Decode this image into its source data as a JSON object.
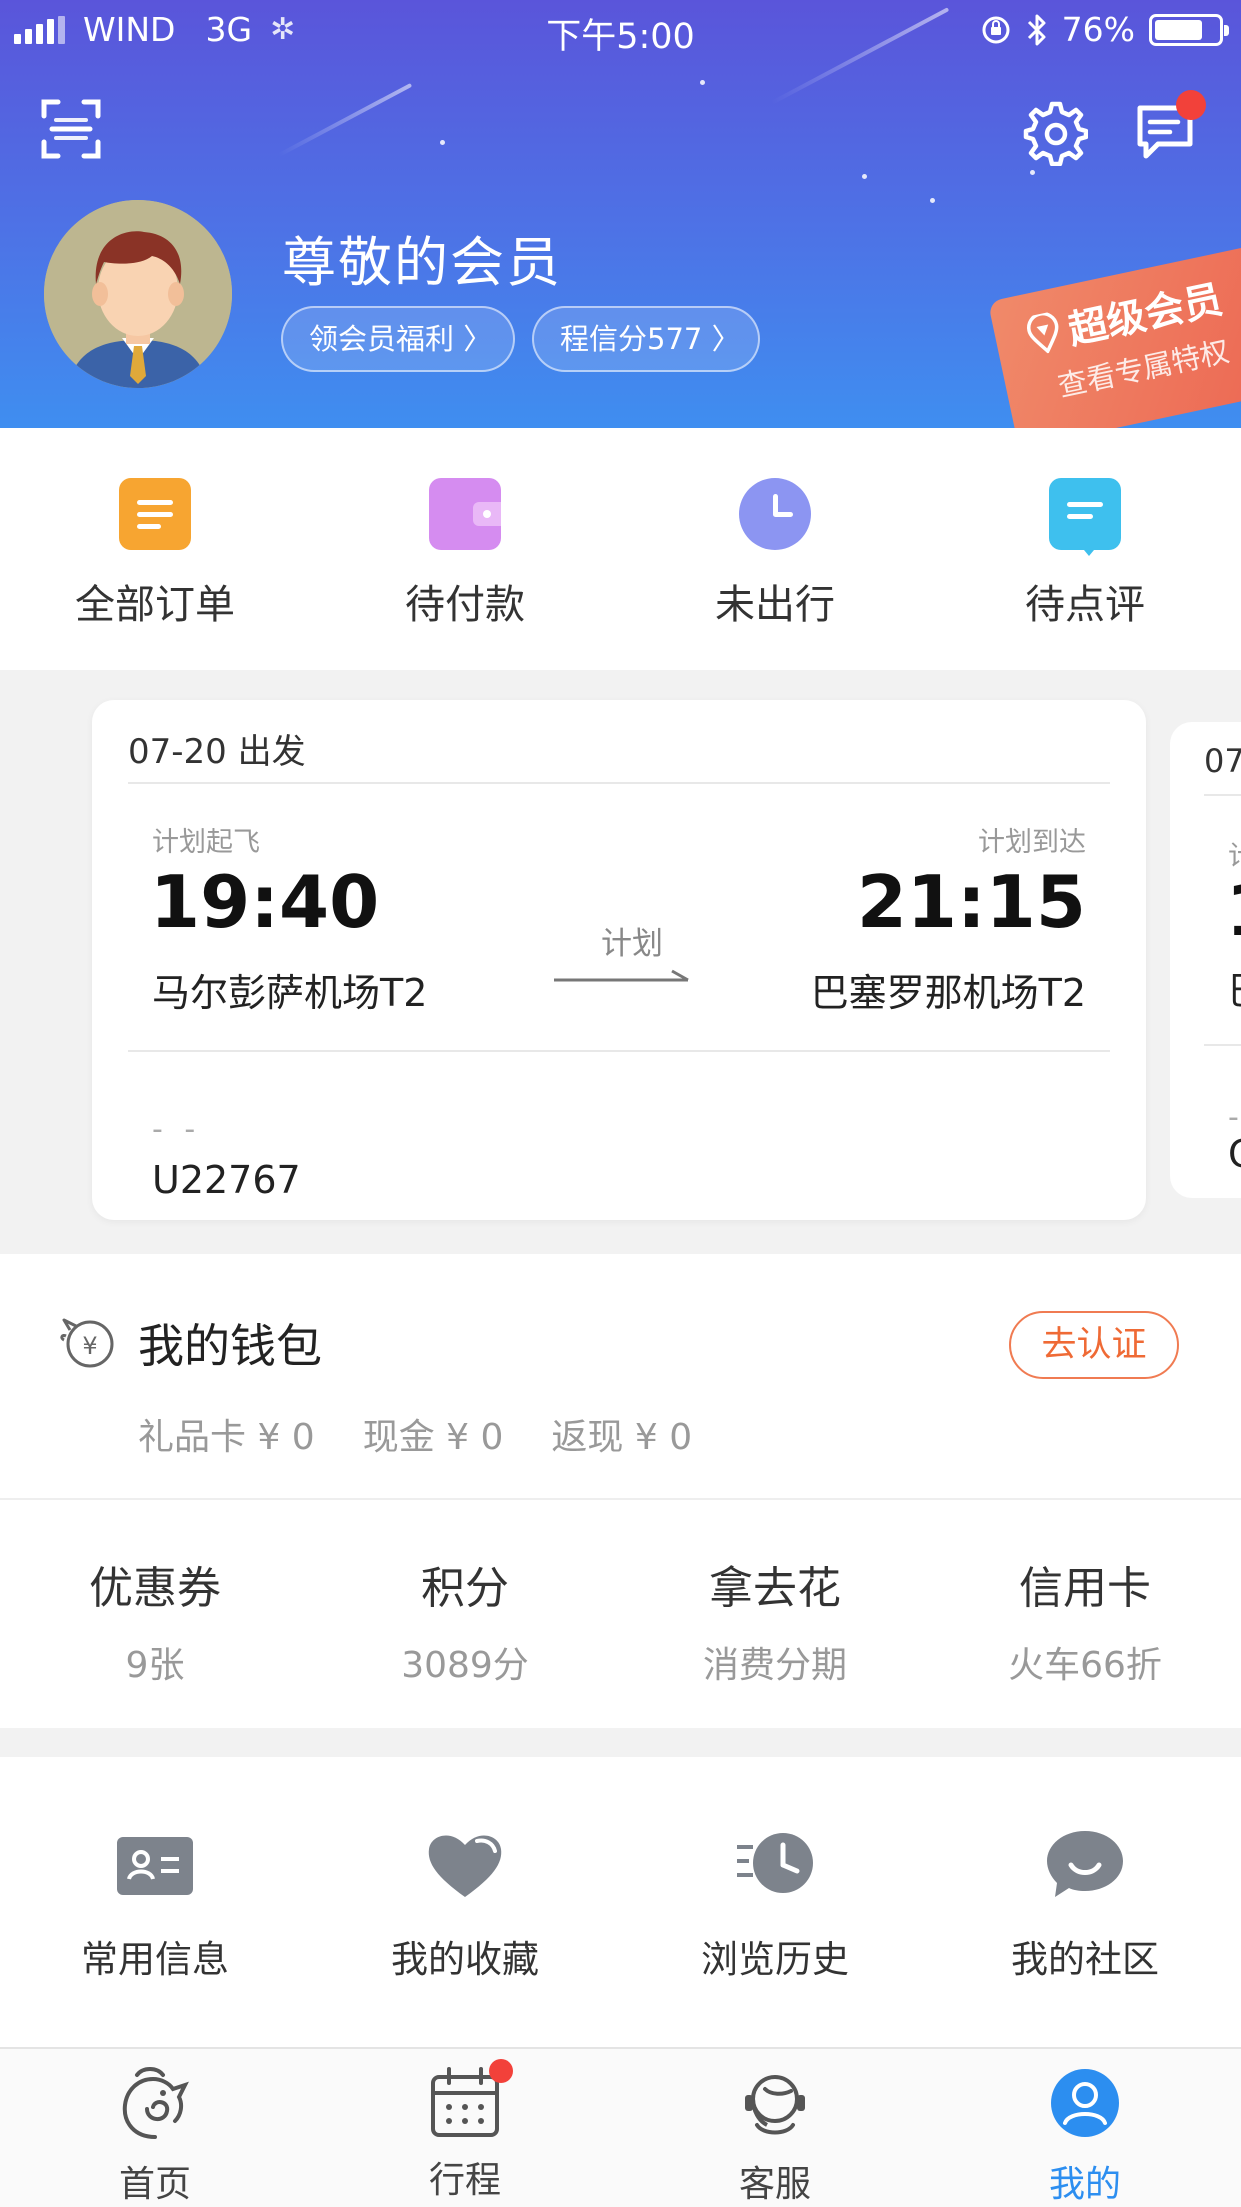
{
  "status_bar": {
    "carrier": "WIND",
    "network": "3G",
    "time": "下午5:00",
    "battery": "76%",
    "battery_level": 0.76
  },
  "header": {
    "icons": [
      "scan-icon",
      "settings-icon",
      "message-icon"
    ],
    "user_name": "尊敬的会员",
    "benefit_link": "领会员福利 〉",
    "credit_link": "程信分577 〉",
    "super_member": {
      "title": "超级会员",
      "subtitle": "查看专属特权"
    }
  },
  "orders": [
    {
      "label": "全部订单",
      "icon": "all-orders-icon",
      "color": "#f7a531"
    },
    {
      "label": "待付款",
      "icon": "wallet-icon",
      "color": "#d58cf0"
    },
    {
      "label": "未出行",
      "icon": "clock-icon",
      "color": "#8c95f2"
    },
    {
      "label": "待点评",
      "icon": "comment-icon",
      "color": "#3ec0ee"
    }
  ],
  "trip_card": {
    "date": "07-20 出发",
    "depart_label": "计划起飞",
    "arrive_label": "计划到达",
    "depart_time": "19:40",
    "arrive_time": "21:15",
    "depart_airport": "马尔彭萨机场T2",
    "arrive_airport": "巴塞罗那机场T2",
    "status": "计划",
    "seat_placeholder": "- -",
    "flight_no": "U22767"
  },
  "trip_card_next": {
    "date_partial": "07",
    "label_partial": "计",
    "time_partial": "1",
    "airport_partial": "巴",
    "dash_partial": "-",
    "flight_partial": "C"
  },
  "wallet": {
    "title": "我的钱包",
    "verify_button": "去认证",
    "gift_card": "礼品卡 ¥ 0",
    "cash": "现金 ¥ 0",
    "cashback": "返现 ¥ 0",
    "assets": [
      {
        "title": "优惠券",
        "sub": "9张"
      },
      {
        "title": "积分",
        "sub": "3089分"
      },
      {
        "title": "拿去花",
        "sub": "消费分期"
      },
      {
        "title": "信用卡",
        "sub": "火车66折"
      }
    ]
  },
  "tools": [
    {
      "label": "常用信息",
      "icon": "id-card-icon"
    },
    {
      "label": "我的收藏",
      "icon": "heart-icon"
    },
    {
      "label": "浏览历史",
      "icon": "history-icon"
    },
    {
      "label": "我的社区",
      "icon": "community-icon"
    }
  ],
  "tabbar": [
    {
      "label": "首页",
      "icon": "home-dolphin-icon",
      "active": false
    },
    {
      "label": "行程",
      "icon": "calendar-icon",
      "active": false,
      "badge": true
    },
    {
      "label": "客服",
      "icon": "customer-service-icon",
      "active": false
    },
    {
      "label": "我的",
      "icon": "user-icon",
      "active": true
    }
  ],
  "colors": {
    "header_top": "#5a55da",
    "header_bottom": "#3f8ef0",
    "accent_blue": "#2c8ef0",
    "verify_orange": "#ef6a35",
    "badge_red": "#f2413a"
  }
}
